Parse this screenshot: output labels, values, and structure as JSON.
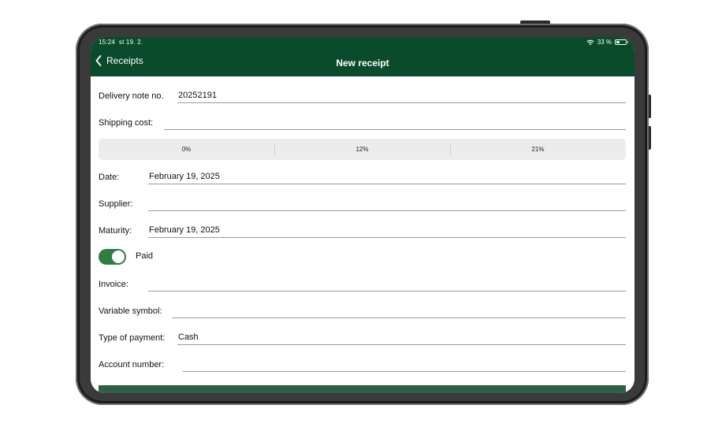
{
  "status_bar": {
    "time": "15:24",
    "date": "st 19. 2.",
    "battery": "33 %",
    "battery_level": 0.33
  },
  "nav": {
    "back_label": "Receipts",
    "title": "New receipt"
  },
  "form": {
    "delivery_note": {
      "label": "Delivery note no.",
      "value": "20252191"
    },
    "shipping_cost": {
      "label": "Shipping cost:",
      "value": ""
    },
    "vat_options": [
      "0%",
      "12%",
      "21%"
    ],
    "date": {
      "label": "Date:",
      "value": "February 19, 2025"
    },
    "supplier": {
      "label": "Supplier:",
      "value": ""
    },
    "maturity": {
      "label": "Maturity:",
      "value": "February 19, 2025"
    },
    "paid": {
      "label": "Paid",
      "on": true
    },
    "invoice": {
      "label": "Invoice:",
      "value": ""
    },
    "variable_symbol": {
      "label": "Variable symbol:",
      "value": ""
    },
    "payment_type": {
      "label": "Type of payment:",
      "value": "Cash"
    },
    "account_number": {
      "label": "Account number:",
      "value": ""
    }
  },
  "colors": {
    "header": "#0a4b2c",
    "toggle_on": "#2e7d41"
  }
}
